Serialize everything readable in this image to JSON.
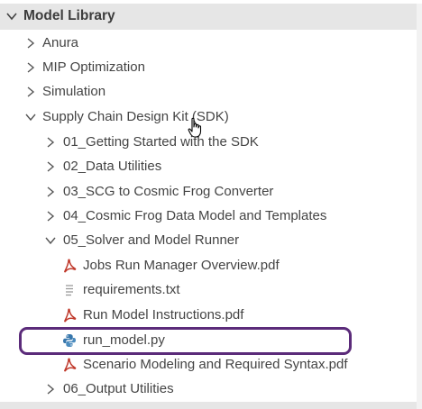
{
  "panel": {
    "title": "Model Library"
  },
  "tree": {
    "anura": "Anura",
    "mip": "MIP Optimization",
    "simulation": "Simulation",
    "sdk": "Supply Chain Design Kit (SDK)",
    "sdk_children": {
      "getting_started": "01_Getting Started with the SDK",
      "data_utilities": "02_Data Utilities",
      "scg_converter": "03_SCG to Cosmic Frog Converter",
      "data_model": "04_Cosmic Frog Data Model and Templates",
      "solver_runner": "05_Solver and Model Runner",
      "solver_files": {
        "jobs_manager": "Jobs Run Manager Overview.pdf",
        "requirements": "requirements.txt",
        "run_instructions": "Run Model Instructions.pdf",
        "run_model": "run_model.py",
        "scenario_syntax": "Scenario Modeling and Required Syntax.pdf"
      },
      "output_utilities": "06_Output Utilities"
    }
  },
  "colors": {
    "header_bg": "#e6e6e6",
    "highlight": "#5b2b7a",
    "pdf_icon": "#c0392b",
    "python_icon": "#3776ab"
  },
  "icons": {
    "collapsed": "chevron-right-icon",
    "expanded": "chevron-down-icon",
    "pdf": "pdf-icon",
    "text": "text-file-icon",
    "python": "python-icon",
    "cursor": "hand-cursor-icon"
  }
}
